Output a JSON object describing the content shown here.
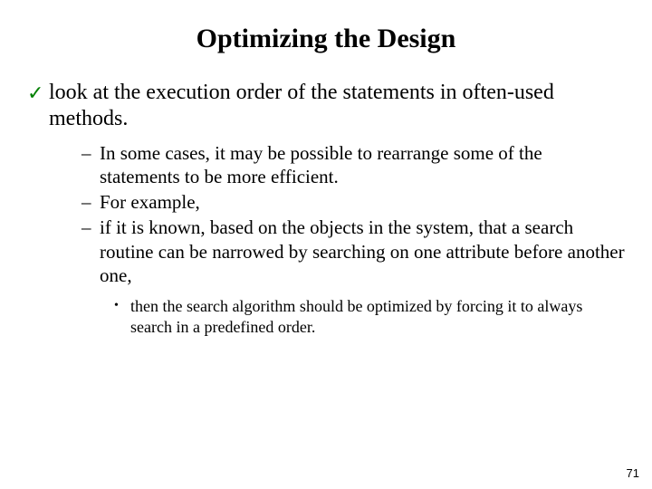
{
  "title": "Optimizing the Design",
  "bullet1": "look at the execution order of the statements in often-used methods.",
  "sub1": "In some cases, it may be possible to rearrange some of the statements to be more efficient.",
  "sub2": "For example,",
  "sub3": " if it is known, based on the objects in the system, that a search routine can be narrowed by searching on one attribute before another one,",
  "subsub1": "then the search algorithm should be optimized by forcing it to always search in a predefined order.",
  "page_number": "71",
  "glyphs": {
    "check": "✓",
    "endash": "–",
    "dot": "•"
  }
}
